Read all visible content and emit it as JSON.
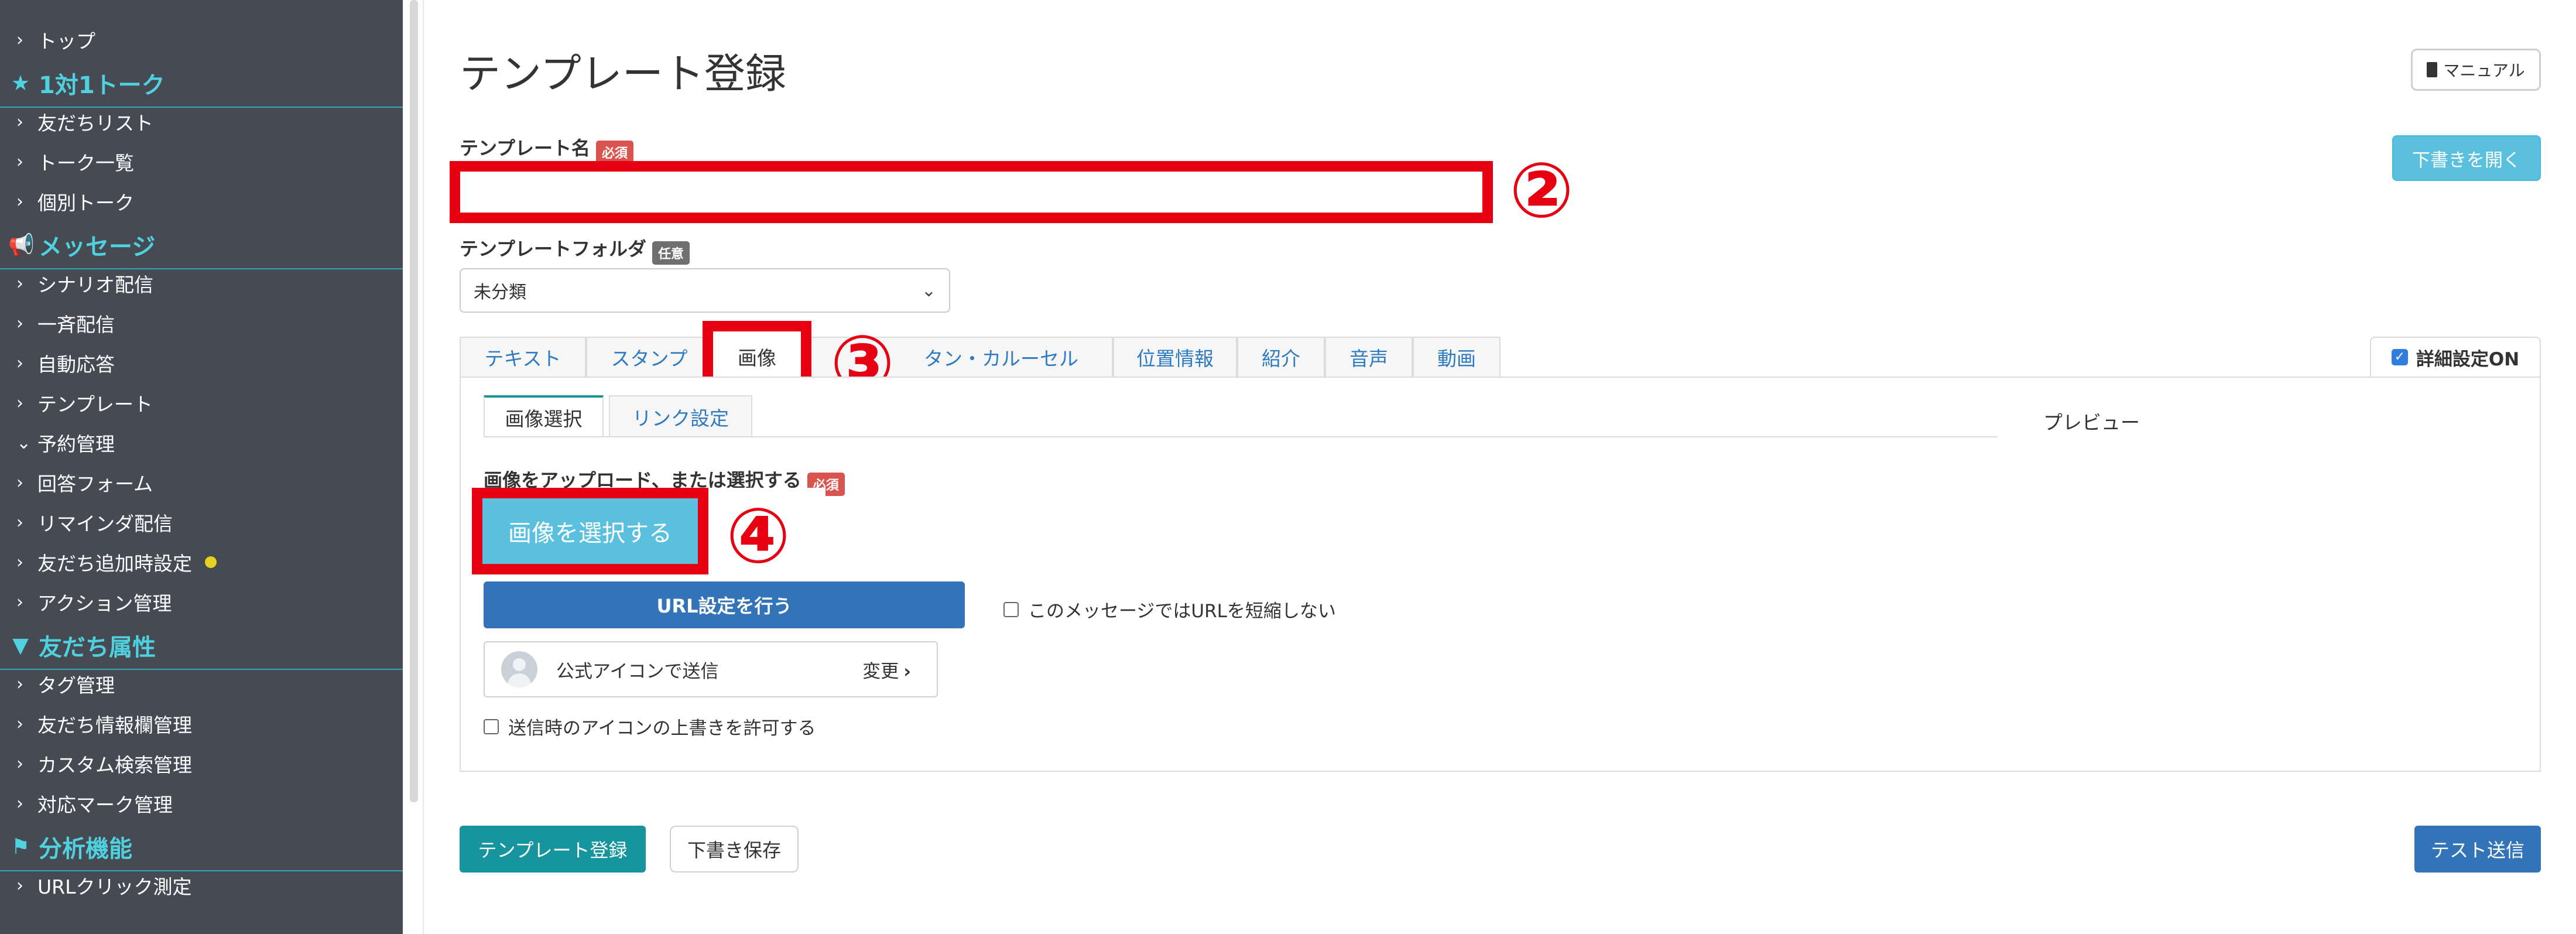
{
  "sidebar": {
    "items": [
      {
        "type": "item",
        "label": "トップ",
        "chev": "›"
      },
      {
        "type": "head",
        "label": "1対1トーク",
        "icon": "star-icon",
        "glyph": "★"
      },
      {
        "type": "item",
        "label": "友だちリスト",
        "chev": "›"
      },
      {
        "type": "item",
        "label": "トーク一覧",
        "chev": "›"
      },
      {
        "type": "item",
        "label": "個別トーク",
        "chev": "›"
      },
      {
        "type": "head",
        "label": "メッセージ",
        "icon": "megaphone-icon",
        "glyph": "📢"
      },
      {
        "type": "item",
        "label": "シナリオ配信",
        "chev": "›"
      },
      {
        "type": "item",
        "label": "一斉配信",
        "chev": "›"
      },
      {
        "type": "item",
        "label": "自動応答",
        "chev": "›"
      },
      {
        "type": "item",
        "label": "テンプレート",
        "chev": "›"
      },
      {
        "type": "item",
        "label": "予約管理",
        "chev": "⌄"
      },
      {
        "type": "item",
        "label": "回答フォーム",
        "chev": "›"
      },
      {
        "type": "item",
        "label": "リマインダ配信",
        "chev": "›"
      },
      {
        "type": "item",
        "label": "友だち追加時設定",
        "chev": "›",
        "dot": true
      },
      {
        "type": "item",
        "label": "アクション管理",
        "chev": "›"
      },
      {
        "type": "head",
        "label": "友だち属性",
        "icon": "filter-icon",
        "glyph": "▼"
      },
      {
        "type": "item",
        "label": "タグ管理",
        "chev": "›"
      },
      {
        "type": "item",
        "label": "友だち情報欄管理",
        "chev": "›"
      },
      {
        "type": "item",
        "label": "カスタム検索管理",
        "chev": "›"
      },
      {
        "type": "item",
        "label": "対応マーク管理",
        "chev": "›"
      },
      {
        "type": "head",
        "label": "分析機能",
        "icon": "flag-icon",
        "glyph": "⚑"
      },
      {
        "type": "item",
        "label": "URLクリック測定",
        "chev": "›"
      }
    ]
  },
  "header": {
    "title": "テンプレート登録",
    "manual_label": "マニュアル",
    "open_draft_label": "下書きを開く"
  },
  "form": {
    "name_label": "テンプレート名",
    "required_badge": "必須",
    "name_value": "",
    "folder_label": "テンプレートフォルダ",
    "optional_badge": "任意",
    "folder_value": "未分類"
  },
  "annotations": {
    "n2": "②",
    "n3": "③",
    "n4": "④"
  },
  "tabs": {
    "items": [
      "テキスト",
      "スタンプ",
      "画像",
      "ボタン・カルーセル",
      "位置情報",
      "紹介",
      "音声",
      "動画"
    ],
    "carousel_visible": "タン・カルーセル",
    "active": "画像",
    "detail_label": "詳細設定ON"
  },
  "subtabs": {
    "items": [
      "画像選択",
      "リンク設定"
    ],
    "active": "画像選択"
  },
  "panel": {
    "upload_label_visible": "画像をアップロード、また",
    "upload_label_tail": "は選択する",
    "select_image_label": "画像を選択する",
    "url_button_label": "URL設定を行う",
    "no_shorten_label": "このメッセージではURLを短縮しない",
    "sender_label": "公式アイコンで送信",
    "change_label": "変更",
    "allow_override_label": "送信時のアイコンの上書きを許可する",
    "preview_label": "プレビュー"
  },
  "footer": {
    "register_label": "テンプレート登録",
    "save_draft_label": "下書き保存",
    "test_send_label": "テスト送信"
  },
  "colors": {
    "sidebar_bg": "#464a53",
    "sidebar_head": "#4fd1e0",
    "teal": "#17959e",
    "blue": "#3374b8",
    "light_blue": "#5bc0de",
    "annotation_red": "#e60012"
  }
}
